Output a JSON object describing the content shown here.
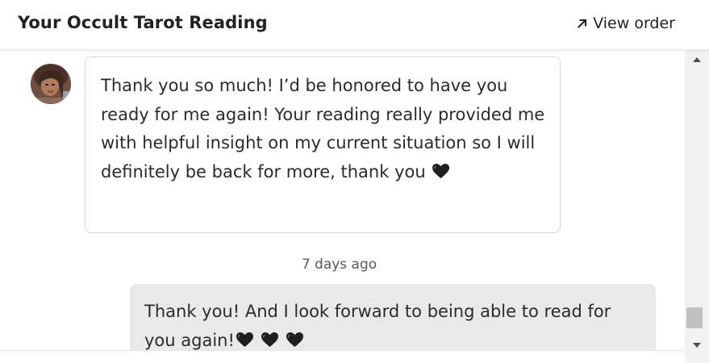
{
  "header": {
    "title": "Your Occult Tarot Reading",
    "view_order_label": "View order",
    "view_order_icon": "arrow-up-right-icon"
  },
  "conversation": {
    "incoming_message": {
      "avatar_icon": "user-avatar",
      "text": "Thank you so much! I’d be honored to have you ready for me again! Your reading really provided me with helpful insight on my current situation so I will definitely be back for more, thank you",
      "emoji": [
        "black-heart"
      ]
    },
    "timestamp": "7 days ago",
    "outgoing_message": {
      "text": "Thank you! And I look forward to being able to read for you again!",
      "emoji": [
        "black-heart",
        "black-heart",
        "black-heart"
      ]
    }
  },
  "colors": {
    "outgoing_bubble": "#e9e9e9",
    "incoming_border": "#d8d8d8",
    "heart": "#1a1a1a"
  }
}
